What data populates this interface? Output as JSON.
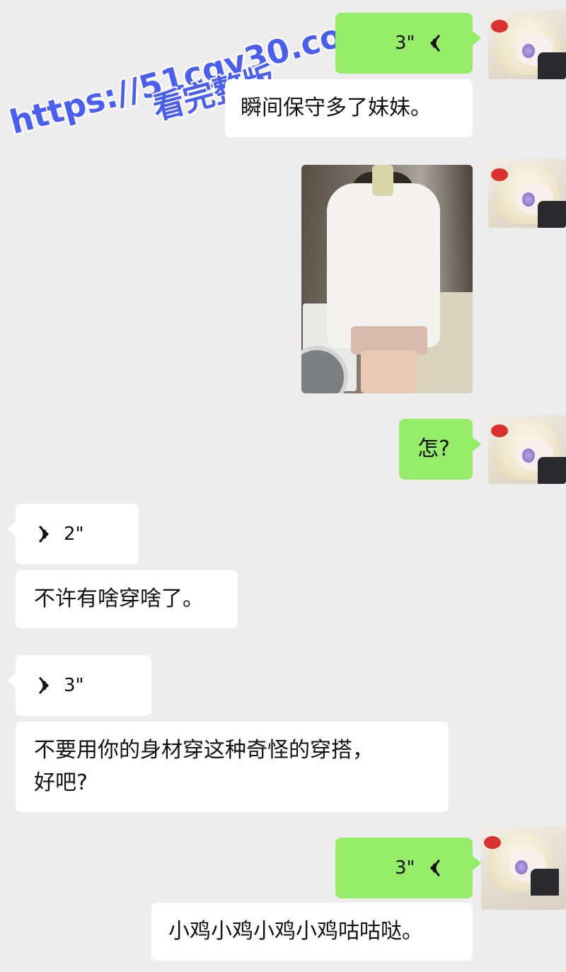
{
  "watermark": {
    "url": "https://51cgy30.com",
    "caption": "看完整版"
  },
  "messages": [
    {
      "side": "right",
      "type": "voice",
      "duration": "3\""
    },
    {
      "side": "right",
      "type": "text",
      "text": "瞬间保守多了妹妹。"
    },
    {
      "side": "right",
      "type": "image"
    },
    {
      "side": "right",
      "type": "text",
      "text": "怎?"
    },
    {
      "side": "left",
      "type": "voice",
      "duration": "2\""
    },
    {
      "side": "left",
      "type": "text",
      "text": "不许有啥穿啥了。"
    },
    {
      "side": "left",
      "type": "voice",
      "duration": "3\""
    },
    {
      "side": "left",
      "type": "text",
      "text_line1": "不要用你的身材穿这种奇怪的穿搭，",
      "text_line2": "好吧?"
    },
    {
      "side": "right",
      "type": "voice",
      "duration": "3\""
    },
    {
      "side": "right",
      "type": "text",
      "text": "小鸡小鸡小鸡小鸡咕咕哒。"
    }
  ],
  "colors": {
    "background": "#ededed",
    "sent_bubble": "#95ec69",
    "received_bubble": "#ffffff",
    "watermark": "#4a5ef0"
  },
  "icons": {
    "voice_sent": "voice-wave-icon",
    "voice_received": "voice-wave-icon",
    "avatar": "anime-doll-avatar"
  }
}
